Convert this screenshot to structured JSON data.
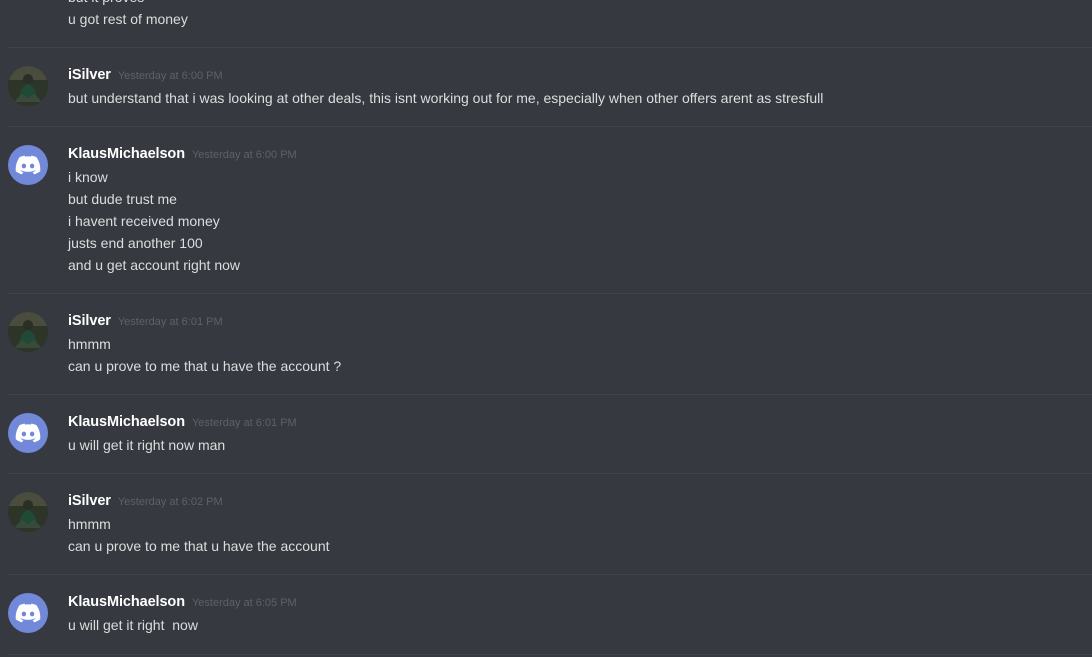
{
  "top_fragment": {
    "lines": [
      "but it proves",
      "u got rest of money"
    ]
  },
  "messages": [
    {
      "username": "iSilver",
      "avatar": "user-photo-avatar",
      "timestamp": "Yesterday at 6:00 PM",
      "lines": [
        "but understand that i was looking at other deals, this isnt working out for me, especially when other offers arent as stresfull"
      ]
    },
    {
      "username": "KlausMichaelson",
      "avatar": "discord-logo-icon",
      "timestamp": "Yesterday at 6:00 PM",
      "lines": [
        "i know",
        "but dude trust me",
        "i havent received money",
        "justs end another 100",
        "and u get account right now"
      ]
    },
    {
      "username": "iSilver",
      "avatar": "user-photo-avatar",
      "timestamp": "Yesterday at 6:01 PM",
      "lines": [
        "hmmm",
        "can u prove to me that u have the account ?"
      ]
    },
    {
      "username": "KlausMichaelson",
      "avatar": "discord-logo-icon",
      "timestamp": "Yesterday at 6:01 PM",
      "lines": [
        "u will get it right now man"
      ]
    },
    {
      "username": "iSilver",
      "avatar": "user-photo-avatar",
      "timestamp": "Yesterday at 6:02 PM",
      "lines": [
        "hmmm",
        "can u prove to me that u have the account"
      ]
    },
    {
      "username": "KlausMichaelson",
      "avatar": "discord-logo-icon",
      "timestamp": "Yesterday at 6:05 PM",
      "lines": [
        "u will get it right  now"
      ]
    }
  ],
  "colors": {
    "background": "#36393f",
    "divider": "#40434a",
    "username": "#ffffff",
    "timestamp": "#5e6168",
    "message_text": "#dcddde",
    "discord_blurple": "#7289da"
  }
}
